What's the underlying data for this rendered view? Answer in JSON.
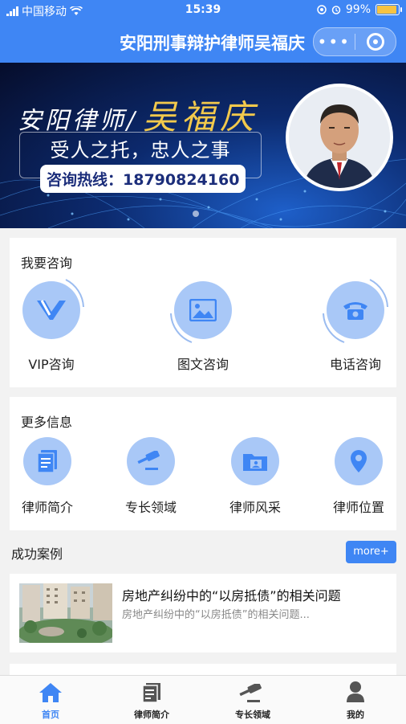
{
  "status_bar": {
    "carrier": "中国移动",
    "time": "15:39",
    "battery": "99%",
    "battery_level": 0.99
  },
  "nav": {
    "title": "安阳刑事辩护律师吴福庆",
    "more_glyph": "•••"
  },
  "banner": {
    "brand_prefix": "安阳律师/",
    "brand_name": "吴福庆",
    "slogan": "受人之托，忠人之事",
    "hotline": "咨询热线：18790824160"
  },
  "consult": {
    "title": "我要咨询",
    "items": [
      {
        "label": "VIP咨询",
        "icon": "vip-icon"
      },
      {
        "label": "图文咨询",
        "icon": "image-icon"
      },
      {
        "label": "电话咨询",
        "icon": "phone-icon"
      }
    ]
  },
  "more_info": {
    "title": "更多信息",
    "items": [
      {
        "label": "律师简介",
        "icon": "document-icon"
      },
      {
        "label": "专长领域",
        "icon": "gavel-icon"
      },
      {
        "label": "律师风采",
        "icon": "folder-icon"
      },
      {
        "label": "律师位置",
        "icon": "location-icon"
      }
    ]
  },
  "cases": {
    "title": "成功案例",
    "more_label": "more+",
    "items": [
      {
        "title": "房地产纠纷中的“以房抵债”的相关问题",
        "summary": "房地产纠纷中的“以房抵债”的相关问题..."
      }
    ]
  },
  "tabbar": {
    "items": [
      {
        "label": "首页",
        "icon": "home-icon",
        "active": true
      },
      {
        "label": "律师简介",
        "icon": "document-icon",
        "active": false
      },
      {
        "label": "专长领域",
        "icon": "gavel-icon",
        "active": false
      },
      {
        "label": "我的",
        "icon": "user-icon",
        "active": false
      }
    ]
  },
  "colors": {
    "primary": "#3f86f4",
    "icon_bubble": "#a9c8f7",
    "icon_fill": "#3f86f4",
    "hotline_text": "#1b2d7a",
    "brand_gold": "#f2c94c"
  }
}
